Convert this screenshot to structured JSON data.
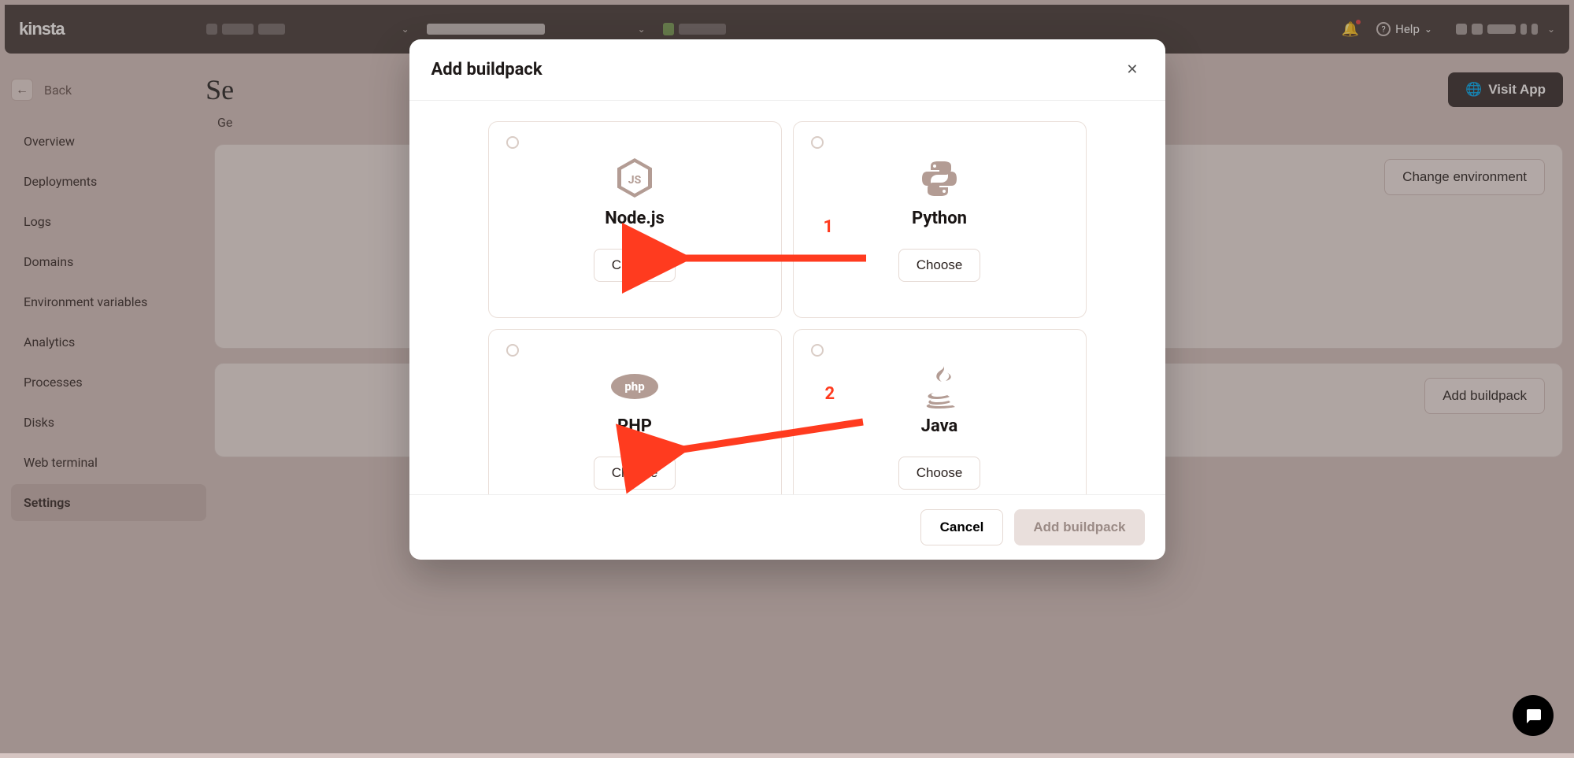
{
  "topbar": {
    "brand": "kinsta",
    "help_label": "Help"
  },
  "back": {
    "label": "Back"
  },
  "page_title_fragment": "Se",
  "visit_button": "Visit App",
  "sidebar": {
    "items": [
      {
        "label": "Overview"
      },
      {
        "label": "Deployments"
      },
      {
        "label": "Logs"
      },
      {
        "label": "Domains"
      },
      {
        "label": "Environment variables"
      },
      {
        "label": "Analytics"
      },
      {
        "label": "Processes"
      },
      {
        "label": "Disks"
      },
      {
        "label": "Web terminal"
      },
      {
        "label": "Settings"
      }
    ],
    "active_index": 9
  },
  "content": {
    "tab_fragment": "Ge",
    "change_env_button": "Change environment",
    "add_buildpack_button": "Add buildpack"
  },
  "modal": {
    "title": "Add buildpack",
    "options": [
      {
        "name": "Node.js",
        "choose": "Choose",
        "icon": "nodejs"
      },
      {
        "name": "Python",
        "choose": "Choose",
        "icon": "python"
      },
      {
        "name": "PHP",
        "choose": "Choose",
        "icon": "php"
      },
      {
        "name": "Java",
        "choose": "Choose",
        "icon": "java"
      }
    ],
    "cancel": "Cancel",
    "submit": "Add buildpack"
  },
  "annotations": {
    "arrow1": "1",
    "arrow2": "2"
  }
}
